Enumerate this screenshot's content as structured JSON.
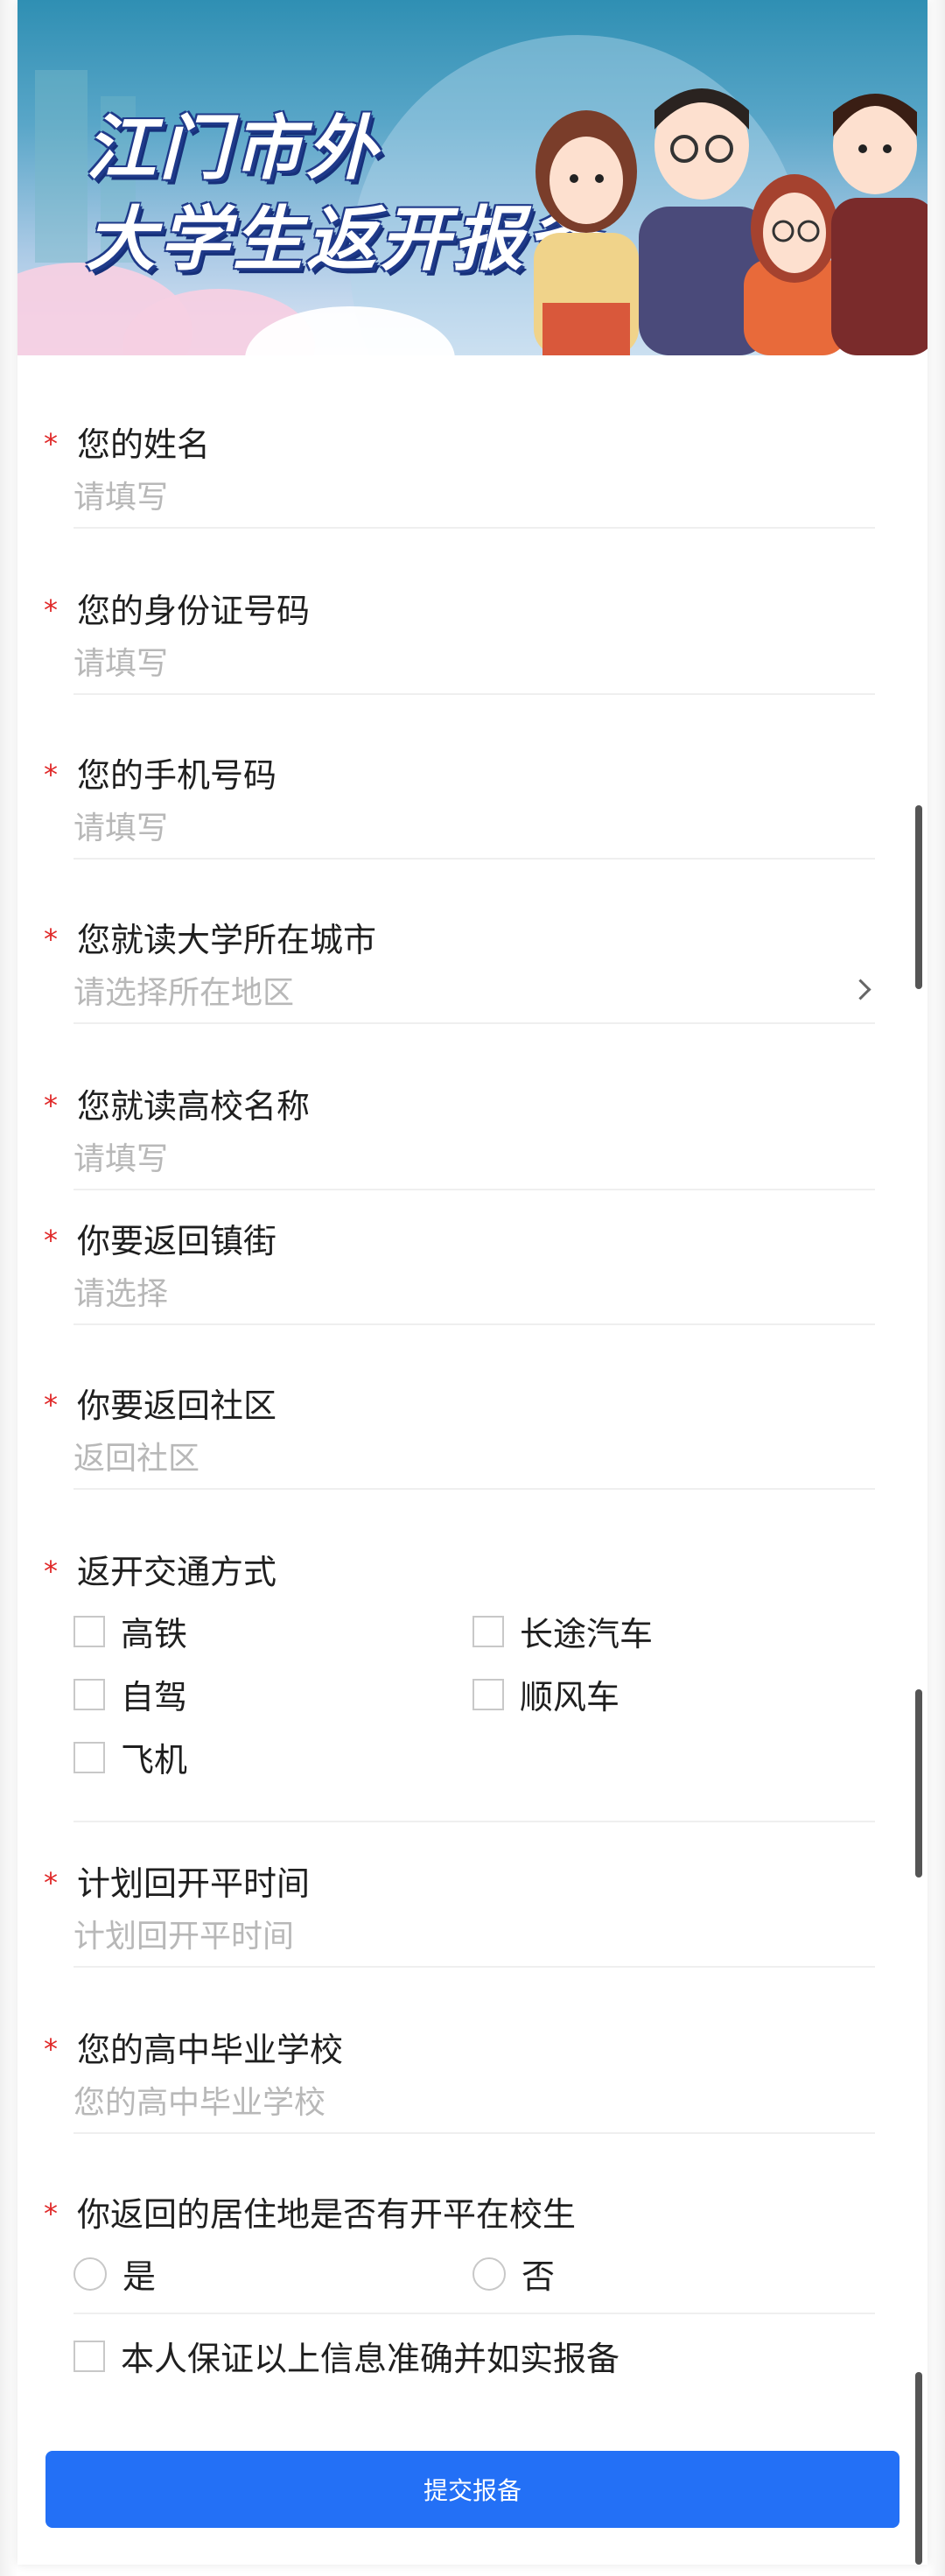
{
  "banner": {
    "title_line1": "江门市外",
    "title_line2": "大学生返开报备"
  },
  "form": {
    "required_mark": "*",
    "fields": [
      {
        "label": "您的姓名",
        "placeholder": "请填写"
      },
      {
        "label": "您的身份证号码",
        "placeholder": "请填写"
      },
      {
        "label": "您的手机号码",
        "placeholder": "请填写"
      },
      {
        "label": "您就读大学所在城市",
        "placeholder": "请选择所在地区"
      },
      {
        "label": "您就读高校名称",
        "placeholder": "请填写"
      },
      {
        "label": "你要返回镇街",
        "placeholder": "请选择"
      },
      {
        "label": "你要返回社区",
        "placeholder": "返回社区"
      }
    ],
    "transport": {
      "label": "返开交通方式",
      "options": [
        "高铁",
        "长途汽车",
        "自驾",
        "顺风车",
        "飞机"
      ]
    },
    "plan_time": {
      "label": "计划回开平时间",
      "placeholder": "计划回开平时间"
    },
    "high_school": {
      "label": "您的高中毕业学校",
      "placeholder": "您的高中毕业学校"
    },
    "resident": {
      "label": "你返回的居住地是否有开平在校生",
      "options": [
        "是",
        "否"
      ]
    },
    "pledge": "本人保证以上信息准确并如实报备",
    "submit_label": "提交报备"
  }
}
